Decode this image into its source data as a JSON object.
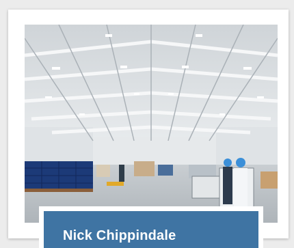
{
  "profile": {
    "name": "Nick Chippindale"
  },
  "photo": {
    "subject": "warehouse-interior-photo"
  },
  "colors": {
    "panel_background": "#3f74a3",
    "panel_text": "#ffffff",
    "card_background": "#ffffff",
    "page_background": "#ececec"
  }
}
